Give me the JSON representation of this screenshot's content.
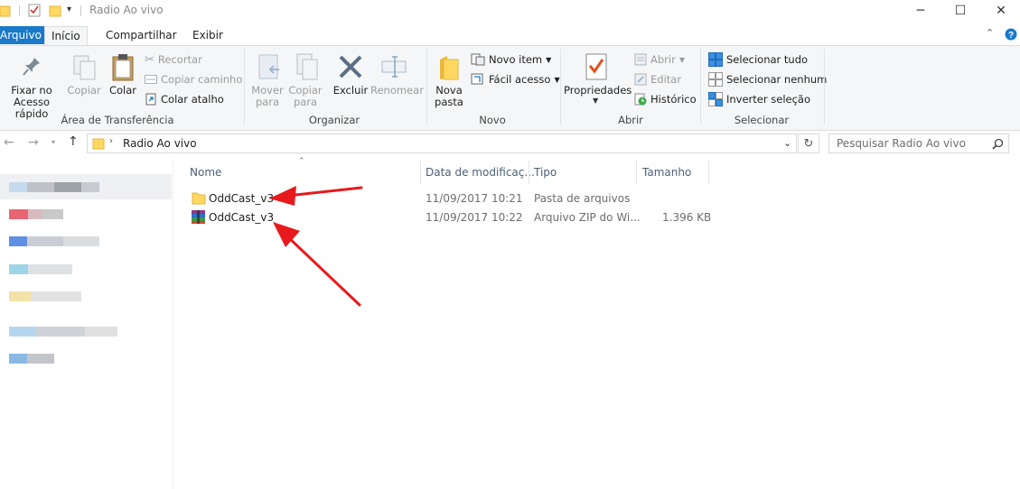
{
  "window": {
    "title": "Radio Ao vivo",
    "minimize_glyph": "─",
    "maximize_glyph": "☐",
    "close_glyph": "✕"
  },
  "ribbon_tabs": [
    {
      "label": "Arquivo"
    },
    {
      "label": "Início"
    },
    {
      "label": "Compartilhar"
    },
    {
      "label": "Exibir"
    }
  ],
  "ribbon": {
    "clipboard": {
      "pin_label_1": "Fixar no",
      "pin_label_2": "Acesso rápido",
      "copy_label": "Copiar",
      "paste_label": "Colar",
      "cut_label": "Recortar",
      "copy_path_label": "Copiar caminho",
      "paste_shortcut_label": "Colar atalho",
      "group_label": "Área de Transferência"
    },
    "organize": {
      "move_label_1": "Mover",
      "move_label_2": "para",
      "copy_to_label_1": "Copiar",
      "copy_to_label_2": "para",
      "delete_label": "Excluir",
      "rename_label": "Renomear",
      "group_label": "Organizar"
    },
    "new": {
      "new_folder_label_1": "Nova",
      "new_folder_label_2": "pasta",
      "new_item_label": "Novo item",
      "easy_access_label": "Fácil acesso",
      "group_label": "Novo"
    },
    "open": {
      "properties_label": "Propriedades",
      "open_label": "Abrir",
      "edit_label": "Editar",
      "history_label": "Histórico",
      "group_label": "Abrir"
    },
    "select": {
      "select_all_label": "Selecionar tudo",
      "select_none_label": "Selecionar nenhum",
      "invert_label": "Inverter seleção",
      "group_label": "Selecionar"
    }
  },
  "address": {
    "path": "Radio Ao vivo",
    "search_placeholder": "Pesquisar Radio Ao vivo"
  },
  "columns": {
    "name": "Nome",
    "date": "Data de modificaç...",
    "type": "Tipo",
    "size": "Tamanho"
  },
  "files": [
    {
      "name": "OddCast_v3",
      "date": "11/09/2017 10:21",
      "type": "Pasta de arquivos",
      "size": "",
      "icon": "folder-icon"
    },
    {
      "name": "OddCast_v3",
      "date": "11/09/2017 10:22",
      "type": "Arquivo ZIP do Wi...",
      "size": "1.396 KB",
      "icon": "winrar-archive-icon"
    }
  ],
  "colors": {
    "accent": "#1979ca",
    "annotation_arrow": "#e8191c",
    "folder": "#ffd862"
  }
}
